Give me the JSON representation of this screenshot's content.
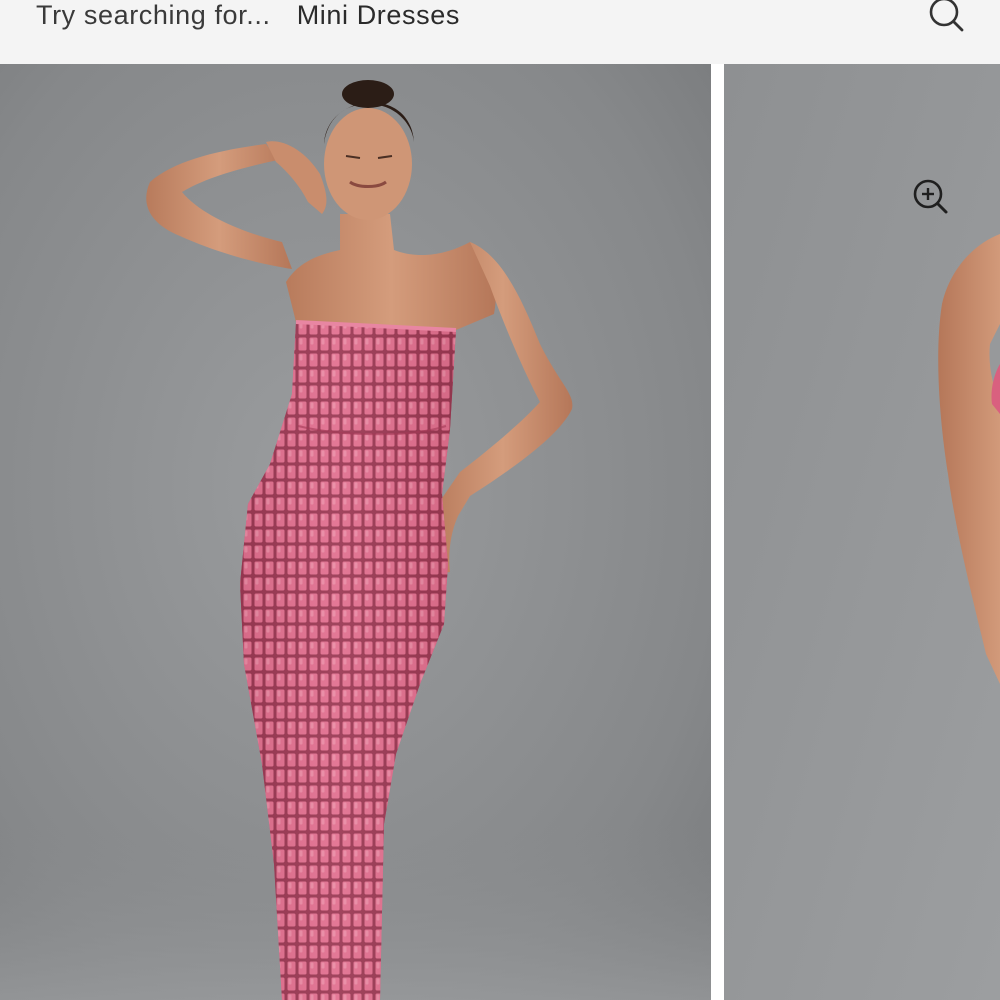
{
  "search": {
    "prompt": "Try searching for...",
    "suggestion": "Mini Dresses",
    "icon": "search-icon"
  },
  "gallery": {
    "zoom_icon": "zoom-in-icon",
    "images": [
      {
        "alt": "product-photo-main"
      },
      {
        "alt": "product-photo-next"
      }
    ]
  },
  "colors": {
    "search_bar_bg": "#f4f4f4",
    "backdrop": "#8a8c8e",
    "dress_pink": "#d9607f",
    "skin": "#c99070"
  }
}
